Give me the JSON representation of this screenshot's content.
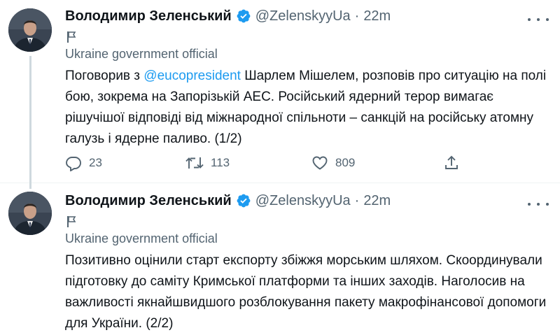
{
  "tweets": [
    {
      "author_name": "Володимир Зеленський",
      "handle": "@ZelenskyyUa",
      "separator": "·",
      "time": "22m",
      "label": "Ukraine government official",
      "text_before_mention": "Поговорив з ",
      "mention": "@eucopresident",
      "text_after_mention": " Шарлем Мішелем, розповів про ситуацію на полі бою, зокрема на Запорізькій АЕС. Російський ядерний терор вимагає рішучішої відповіді від міжнародної спільноти – санкцій на російську атомну галузь і ядерне паливо. (1/2)",
      "replies": "23",
      "retweets": "113",
      "likes": "809"
    },
    {
      "author_name": "Володимир Зеленський",
      "handle": "@ZelenskyyUa",
      "separator": "·",
      "time": "22m",
      "label": "Ukraine government official",
      "text": "Позитивно оцінили старт експорту збіжжя морським шляхом. Скоординували підготовку до саміту Кримської платформи та інших заходів. Наголосив на важливості якнайшвидшого розблокування пакету макрофінансової допомоги для України. (2/2)"
    }
  ],
  "colors": {
    "accent": "#1d9bf0",
    "secondary_text": "#536471",
    "primary_text": "#0f1419",
    "thread_line": "#cfd9de"
  },
  "icons": {
    "verified": "verified-badge-icon",
    "flag": "flag-icon",
    "more": "more-icon",
    "reply": "reply-icon",
    "retweet": "retweet-icon",
    "like": "heart-icon",
    "share": "share-icon"
  }
}
